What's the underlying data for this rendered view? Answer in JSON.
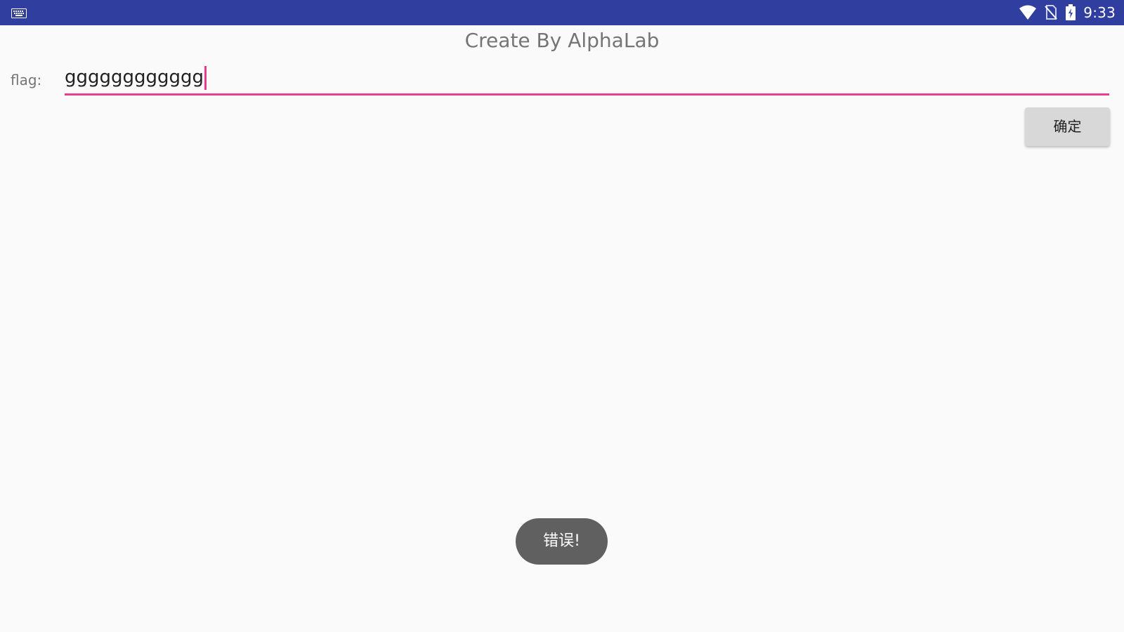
{
  "status_bar": {
    "time": "9:33",
    "icons": [
      "keyboard-icon",
      "wifi-icon",
      "no-sim-icon",
      "battery-charging-icon"
    ],
    "background_color": "#303f9f"
  },
  "app": {
    "title": "Create By AlphaLab"
  },
  "form": {
    "flag_label": "flag:",
    "flag_value": "gggggggggggg",
    "confirm_label": "确定",
    "accent_color": "#e83e8c"
  },
  "toast": {
    "message": "错误!"
  }
}
